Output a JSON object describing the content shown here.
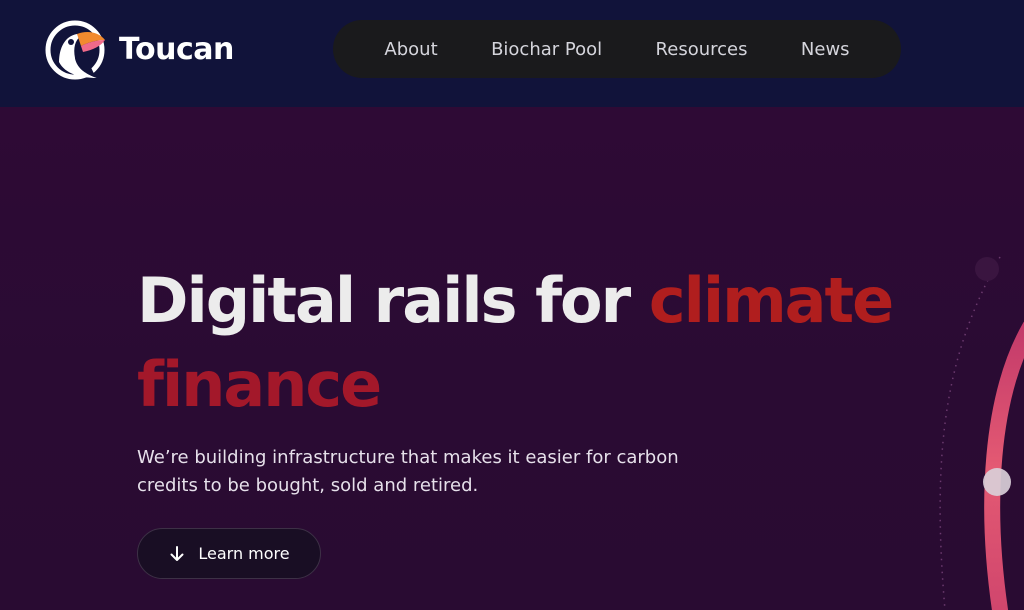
{
  "brand": {
    "name": "Toucan",
    "logo_icon": "toucan-logo-icon"
  },
  "nav": {
    "items": [
      {
        "label": "About"
      },
      {
        "label": "Biochar Pool"
      },
      {
        "label": "Resources"
      },
      {
        "label": "News"
      }
    ]
  },
  "hero": {
    "headline_part1": "Digital rails for ",
    "headline_accent1": "climate",
    "headline_accent2": "finance",
    "subtitle": "We’re building infrastructure that makes it easier for carbon credits to be bought, sold and retired.",
    "cta_label": "Learn more",
    "cta_icon": "arrow-down-icon"
  },
  "colors": {
    "header_bg": "#11133a",
    "hero_bg": "#2a0b33",
    "nav_bg": "#1a1a1c",
    "accent_red": "#b01e1e",
    "ring_pink": "#d94a6f"
  }
}
